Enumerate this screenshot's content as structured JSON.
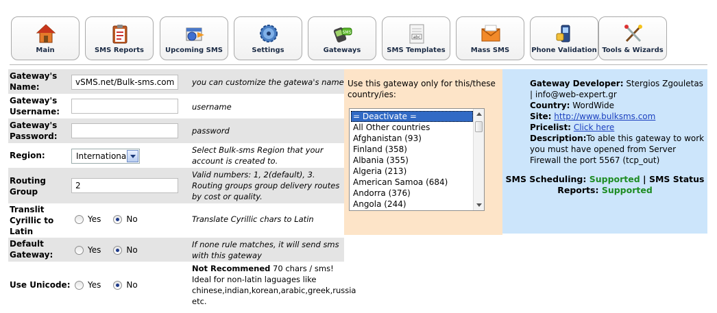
{
  "nav": [
    {
      "label": "Main",
      "icon": "home-icon"
    },
    {
      "label": "SMS Reports",
      "icon": "clipboard-icon"
    },
    {
      "label": "Upcoming SMS",
      "icon": "calendar-icon"
    },
    {
      "label": "Settings",
      "icon": "gear-icon"
    },
    {
      "label": "Gateways",
      "icon": "phone-sms-icon"
    },
    {
      "label": "SMS Templates",
      "icon": "template-icon"
    },
    {
      "label": "Mass SMS",
      "icon": "envelope-icon"
    },
    {
      "label": "Phone Validation",
      "icon": "mobile-phone-icon"
    },
    {
      "label": "Tools & Wizards",
      "icon": "tools-icon"
    }
  ],
  "form": {
    "name": {
      "label": "Gateway's Name:",
      "value": "vSMS.net/Bulk-sms.com",
      "desc": "you can customize the gatewa's name"
    },
    "username": {
      "label": "Gateway's Username:",
      "value": "",
      "desc": "username"
    },
    "password": {
      "label": "Gateway's Password:",
      "value": "",
      "desc": "password"
    },
    "region": {
      "label": "Region:",
      "value": "International",
      "desc": "Select Bulk-sms Region that your account is created to."
    },
    "routing": {
      "label": "Routing Group",
      "value": "2",
      "desc": "Valid numbers: 1, 2(default), 3. Routing groups group delivery routes by cost or quality."
    },
    "translit": {
      "label": "Translit Cyrillic to Latin",
      "yes": "Yes",
      "no": "No",
      "selected": "No",
      "desc": "Translate Cyrillic chars to Latin"
    },
    "default": {
      "label": "Default Gateway:",
      "yes": "Yes",
      "no": "No",
      "selected": "No",
      "desc": "If none rule matches, it will send sms with this gateway"
    },
    "unicode": {
      "label": "Use Unicode:",
      "yes": "Yes",
      "no": "No",
      "selected": "No",
      "desc_bold": "Not Recommened",
      "desc": " 70 chars / sms! Ideal for non-latin laguages like chinese,indian,korean,arabic,greek,russia etc."
    }
  },
  "countries": {
    "title": "Use this gateway only for this/these country/ies:",
    "options": [
      "= Deactivate =",
      "All Other countries",
      "Afghanistan (93)",
      "Finland (358)",
      "Albania (355)",
      "Algeria (213)",
      "American Samoa (684)",
      "Andorra (376)",
      "Angola (244)"
    ],
    "selected": "= Deactivate ="
  },
  "info": {
    "developer_label": "Gateway Developer:",
    "developer": "Stergios Zgouletas | info@web-expert.gr",
    "country_label": "Country:",
    "country": "WordWide",
    "site_label": "Site:",
    "site": "http://www.bulksms.com",
    "pricelist_label": "Pricelist:",
    "pricelist": "Click here",
    "description_label": "Description:",
    "description": "To able this gateway to work you must have opened from Server Firewall the port 5567 (tcp_out)",
    "scheduling_label": "SMS Scheduling:",
    "scheduling": "Supported",
    "separator": "|",
    "status_label": "SMS Status Reports:",
    "status": "Supported"
  },
  "colors": {
    "country_panel": "#fde4c8",
    "info_panel": "#cce5fb",
    "row_shade": "#e4e4e4",
    "supported": "#1e8c23",
    "link": "#1a3fbf"
  }
}
